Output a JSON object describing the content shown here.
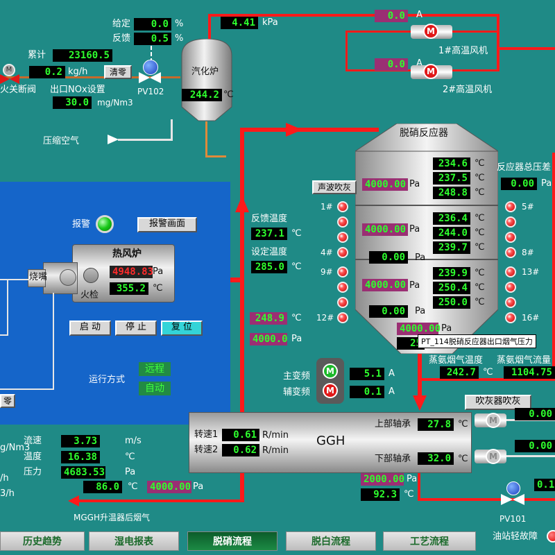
{
  "top_left": {
    "setpoint_label": "给定",
    "setpoint_value": "0.0",
    "setpoint_unit": "%",
    "feedback_label": "反馈",
    "feedback_value": "0.5",
    "feedback_unit": "%",
    "total_label": "累计",
    "total_value": "23160.5",
    "flow_value": "0.2",
    "flow_unit": "kg/h",
    "clear_btn": "清零",
    "shutoff_valve_label": "火关断阀",
    "valve_pv102": "PV102",
    "nox_label": "出口NOx设置",
    "nox_value": "30.0",
    "nox_unit": "mg/Nm3",
    "compressed_air": "压缩空气"
  },
  "vaporizer": {
    "title": "汽化炉",
    "temp": "244.2",
    "temp_unit": "℃",
    "pressure": "4.41",
    "pressure_unit": "kPa"
  },
  "fans": [
    {
      "current": "0.0",
      "unit": "A",
      "name": "1#高温风机"
    },
    {
      "current": "0.0",
      "unit": "A",
      "name": "2#高温风机"
    }
  ],
  "reactor": {
    "title": "脱硝反应器",
    "soot_btn": "声波吹灰",
    "top_pressure": "4000.00",
    "pa": "Pa",
    "temps": [
      "234.6",
      "237.5",
      "248.8",
      "236.4",
      "244.0",
      "239.7",
      "239.9",
      "250.4",
      "250.0"
    ],
    "deg": "℃",
    "layer_pressures": [
      "4000.00",
      "0.00",
      "4000.00",
      "0.00"
    ],
    "bottom_pressure": "4000.00",
    "bottom_temp": "25",
    "tooltip": "PT_114脱硝反应器出口烟气压力",
    "total_diff_label": "反应器总压差",
    "total_diff_value": "0.00",
    "total_diff_unit": "Pa",
    "left_labels": [
      "1#",
      "4#",
      "9#",
      "12#"
    ],
    "right_labels": [
      "5#",
      "8#",
      "13#",
      "16#"
    ]
  },
  "ammonia": {
    "temp_label": "蒸氨烟气温度",
    "temp_value": "242.7",
    "temp_unit": "℃",
    "flow_label": "蒸氨烟气流量",
    "flow_value": "1104.75"
  },
  "middle": {
    "fb_temp_label": "反馈温度",
    "fb_temp_value": "237.1",
    "fb_unit": "℃",
    "set_temp_label": "设定温度",
    "set_temp_value": "285.0",
    "set_unit": "℃",
    "gas_temp": "248.9",
    "gas_temp_unit": "℃",
    "gas_pressure": "4000.0",
    "gas_pressure_unit": "Pa"
  },
  "hot_air_furnace": {
    "alarm_label": "报警",
    "alarm_screen_btn": "报警画面",
    "title": "热风炉",
    "pressure": "4948.83",
    "pressure_unit": "Pa",
    "temp": "355.2",
    "temp_unit": "℃",
    "burner": "烧嘴",
    "fire_check": "火检",
    "start_btn": "启 动",
    "stop_btn": "停 止",
    "reset_btn": "复 位",
    "run_mode_label": "运行方式",
    "mode_remote": "远程",
    "mode_auto": "自动",
    "zero_btn": "零"
  },
  "ggh": {
    "title": "GGH",
    "speed1_label": "转速1",
    "speed1_value": "0.61",
    "speed1_unit": "R/min",
    "speed2_label": "转速2",
    "speed2_value": "0.62",
    "speed2_unit": "R/min",
    "upper_bearing_label": "上部轴承",
    "upper_bearing_value": "27.8",
    "upper_bearing_unit": "℃",
    "lower_bearing_label": "下部轴承",
    "lower_bearing_value": "32.0",
    "lower_bearing_unit": "℃",
    "main_vfd_label": "主变频",
    "main_vfd_value": "5.1",
    "main_vfd_unit": "A",
    "aux_vfd_label": "辅变频",
    "aux_vfd_value": "0.1",
    "aux_vfd_unit": "A",
    "soot_blower_btn": "吹灰器吹灰",
    "blower1": "0.00",
    "blower2": "0.00",
    "out_pressure": "2000.00",
    "out_pressure_unit": "Pa",
    "out_temp": "92.3",
    "out_temp_unit": "℃"
  },
  "bottom_left": {
    "nm3": "g/Nm3",
    "h1": "/h",
    "h2": "3/h",
    "flow_label": "流速",
    "flow_value": "3.73",
    "flow_unit": "m/s",
    "temp_label": "温度",
    "temp_value": "16.38",
    "temp_unit": "℃",
    "pressure_label": "压力",
    "pressure_value": "4683.53",
    "pressure_unit": "Pa",
    "t_value": "86.0",
    "t_unit": "℃",
    "p_value": "4000.00",
    "p_unit": "Pa",
    "after_ggh": "MGGH升温器后烟气"
  },
  "bottom_right": {
    "pv101": "PV101",
    "oil_fault": "油站轻故障",
    "partial_value": "0.1"
  },
  "tabs": [
    "历史趋势",
    "湿电报表",
    "脱硝流程",
    "脱白流程",
    "工艺流程"
  ],
  "active_tab": "脱硝流程"
}
